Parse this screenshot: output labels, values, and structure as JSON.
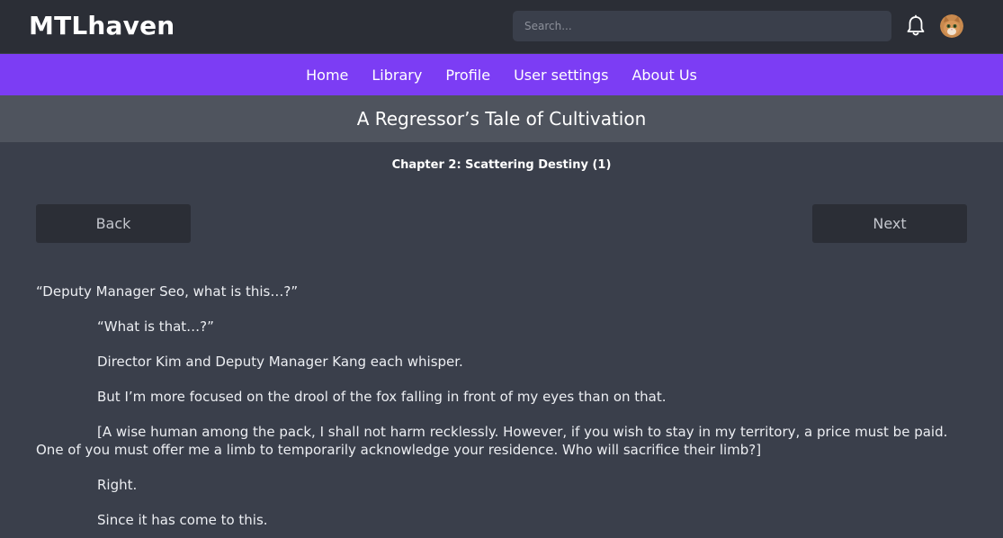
{
  "header": {
    "logo": "MTLhaven",
    "search_placeholder": "Search...",
    "bell_icon": "bell-icon",
    "avatar_icon": "cat-avatar"
  },
  "nav": {
    "items": [
      {
        "label": "Home"
      },
      {
        "label": "Library"
      },
      {
        "label": "Profile"
      },
      {
        "label": "User settings"
      },
      {
        "label": "About Us"
      }
    ]
  },
  "novel": {
    "title": "A Regressor’s Tale of Cultivation",
    "chapter": "Chapter 2: Scattering Destiny (1)"
  },
  "buttons": {
    "back": "Back",
    "next": "Next"
  },
  "paragraphs": [
    "“Deputy Manager Seo, what is this…?”",
    "“What is that…?”",
    "Director Kim and Deputy Manager Kang each whisper.",
    "But I’m more focused on the drool of the fox falling in front of my eyes than on that.",
    "[A wise human among the pack, I shall not harm recklessly. However, if you wish to stay in my territory, a price must be paid. One of you must offer me a limb to temporarily acknowledge your residence. Who will sacrifice their limb?]",
    "Right.",
    "Since it has come to this."
  ],
  "colors": {
    "nav_accent": "#7c3df4",
    "topbar": "#2b2e36",
    "background": "#3a3f4b"
  }
}
